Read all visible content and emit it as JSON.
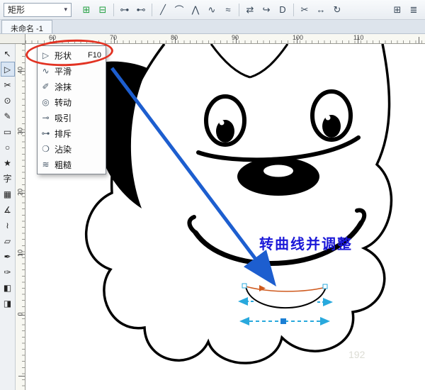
{
  "property_bar": {
    "tool_dropdown": "矩形",
    "icons": [
      {
        "type": "icon",
        "name": "add-node-icon",
        "glyph": "⊞",
        "color": "#1f9e3e"
      },
      {
        "type": "icon",
        "name": "delete-node-icon",
        "glyph": "⊟",
        "color": "#1f9e3e"
      },
      {
        "type": "sep"
      },
      {
        "type": "icon",
        "name": "join-nodes-icon",
        "glyph": "⊶"
      },
      {
        "type": "icon",
        "name": "break-curve-icon",
        "glyph": "⊷"
      },
      {
        "type": "sep"
      },
      {
        "type": "icon",
        "name": "convert-to-line-icon",
        "glyph": "╱"
      },
      {
        "type": "icon",
        "name": "convert-to-curve-icon",
        "glyph": "⌒"
      },
      {
        "type": "icon",
        "name": "cusp-node-icon",
        "glyph": "⋀"
      },
      {
        "type": "icon",
        "name": "smooth-node-icon",
        "glyph": "∿"
      },
      {
        "type": "icon",
        "name": "symmetric-node-icon",
        "glyph": "≈"
      },
      {
        "type": "sep"
      },
      {
        "type": "icon",
        "name": "reverse-direction-icon",
        "glyph": "⇄"
      },
      {
        "type": "icon",
        "name": "extend-curve-icon",
        "glyph": "↪"
      },
      {
        "type": "icon",
        "name": "close-curve-icon",
        "glyph": "D"
      },
      {
        "type": "sep"
      },
      {
        "type": "icon",
        "name": "extract-subpath-icon",
        "glyph": "✂"
      },
      {
        "type": "icon",
        "name": "stretch-nodes-icon",
        "glyph": "↔"
      },
      {
        "type": "icon",
        "name": "rotate-nodes-icon",
        "glyph": "↻"
      }
    ],
    "right_icons": [
      {
        "type": "icon",
        "name": "elastic-mode-icon",
        "glyph": "⊞"
      },
      {
        "type": "icon",
        "name": "select-all-nodes-icon",
        "glyph": "≣"
      }
    ]
  },
  "tabs": [
    {
      "label": "未命名 -1"
    }
  ],
  "rulers": {
    "horizontal": [
      "60",
      "70",
      "80",
      "90",
      "100",
      "110"
    ],
    "vertical": [
      "40",
      "30",
      "20",
      "10",
      "0"
    ]
  },
  "toolbox": {
    "tools": [
      {
        "name": "pick-tool",
        "glyph": "↖"
      },
      {
        "name": "shape-tool",
        "glyph": "▷",
        "active": true
      },
      {
        "name": "crop-tool",
        "glyph": "✂"
      },
      {
        "name": "zoom-tool",
        "glyph": "⊙"
      },
      {
        "name": "freehand-tool",
        "glyph": "✎"
      },
      {
        "name": "rectangle-tool",
        "glyph": "▭"
      },
      {
        "name": "ellipse-tool",
        "glyph": "○"
      },
      {
        "name": "polygon-tool",
        "glyph": "★"
      },
      {
        "name": "text-tool",
        "glyph": "字"
      },
      {
        "name": "table-tool",
        "glyph": "▦"
      },
      {
        "name": "dimension-tool",
        "glyph": "∡"
      },
      {
        "name": "connector-tool",
        "glyph": "≀"
      },
      {
        "name": "shadow-tool",
        "glyph": "▱"
      },
      {
        "name": "eyedropper-tool",
        "glyph": "✒"
      },
      {
        "name": "outline-pen-tool",
        "glyph": "✑"
      },
      {
        "name": "fill-tool",
        "glyph": "◧"
      },
      {
        "name": "interactive-fill-tool",
        "glyph": "◨"
      }
    ]
  },
  "flyout": {
    "items": [
      {
        "name": "shape",
        "label": "形状",
        "shortcut": "F10",
        "glyph": "▷"
      },
      {
        "name": "smooth",
        "label": "平滑",
        "glyph": "∿"
      },
      {
        "name": "smudge",
        "label": "涂抹",
        "glyph": "✐"
      },
      {
        "name": "twirl",
        "label": "转动",
        "glyph": "◎"
      },
      {
        "name": "attract",
        "label": "吸引",
        "glyph": "⊸"
      },
      {
        "name": "repel",
        "label": "排斥",
        "glyph": "⊶"
      },
      {
        "name": "smear",
        "label": "沾染",
        "glyph": "❍"
      },
      {
        "name": "roughen",
        "label": "粗糙",
        "glyph": "≋"
      }
    ]
  },
  "annotation": {
    "label": "转曲线并调整"
  },
  "watermark": {
    "text": "192"
  },
  "colors": {
    "arrow_blue": "#1d5ecf",
    "annotation_blue": "#1b18d8",
    "highlight_red": "#e23222",
    "selection_cyan": "#29a9dd",
    "node_blue": "#1c7fd4",
    "direction_orange": "#cf5a1e"
  }
}
